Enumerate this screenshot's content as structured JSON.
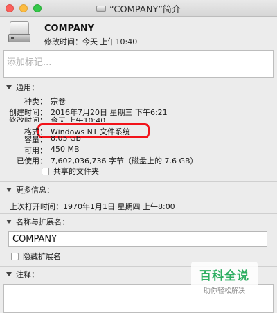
{
  "window": {
    "title": "“COMPANY”简介"
  },
  "header": {
    "name": "COMPANY",
    "modified": "修改时间：今天 上午10:40"
  },
  "tags": {
    "placeholder": "添加标记..."
  },
  "general": {
    "heading": "通用：",
    "rows": [
      {
        "key": "种类：",
        "value": "宗卷"
      },
      {
        "key": "创建时间：",
        "value": "2016年7月20日 星期三 下午6:21"
      },
      {
        "key": "修改时间：",
        "value": "今天 上午10:40"
      },
      {
        "key": "格式：",
        "value": "Windows NT 文件系统"
      },
      {
        "key": "容量：",
        "value": "8.05 GB"
      },
      {
        "key": "可用：",
        "value": "450 MB"
      },
      {
        "key": "已使用：",
        "value": "7,602,036,736 字节（磁盘上的 7.6 GB）"
      }
    ],
    "shared_folder_label": "共享的文件夹"
  },
  "more_info": {
    "heading": "更多信息：",
    "last_opened": "上次打开时间：1970年1月1日 星期四 上午8:00"
  },
  "name_ext": {
    "heading": "名称与扩展名：",
    "value": "COMPANY",
    "hide_ext_label": "隐藏扩展名"
  },
  "comments": {
    "heading": "注释："
  },
  "watermark": {
    "title": "百科全说",
    "subtitle": "助你轻松解决"
  },
  "colors": {
    "highlight": "#f2131a",
    "watermark_green": "#2eae62"
  }
}
